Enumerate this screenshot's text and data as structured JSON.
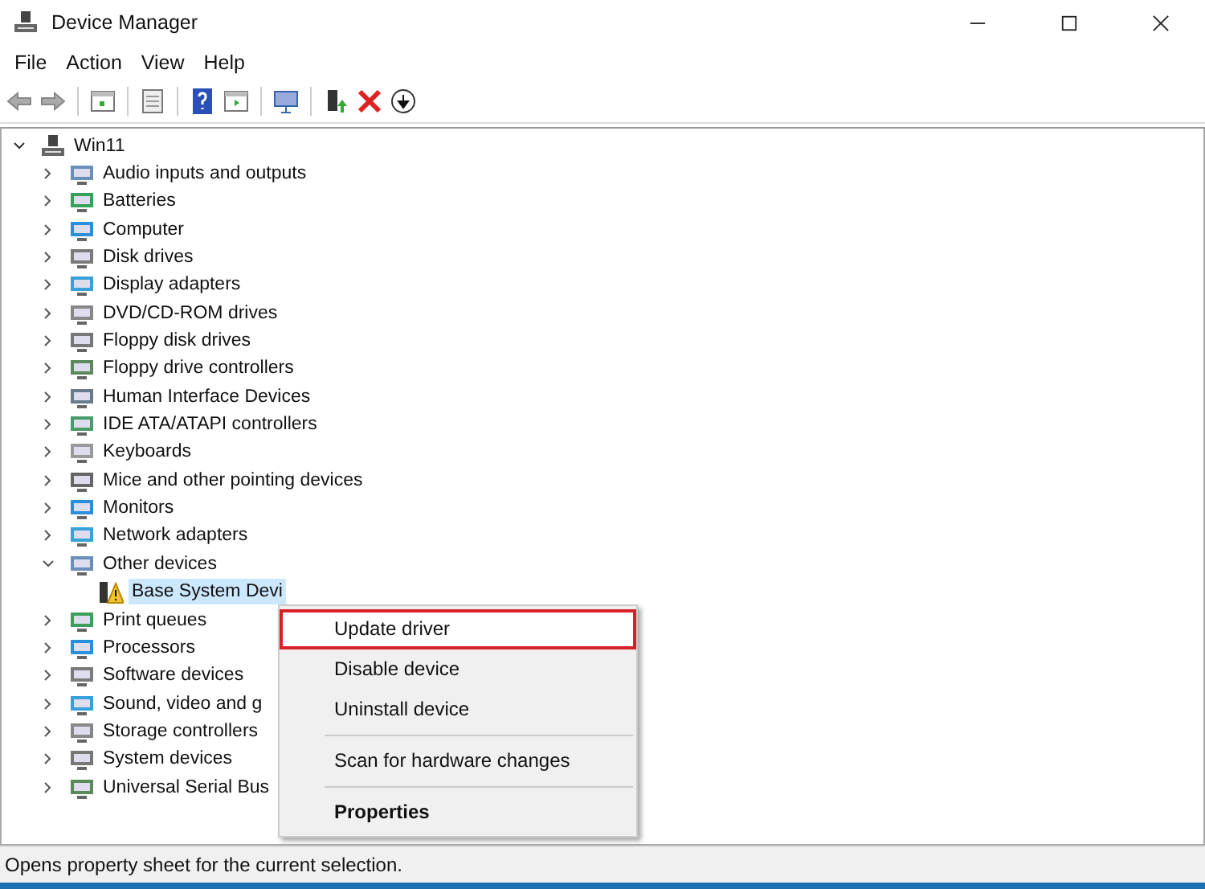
{
  "window": {
    "title": "Device Manager"
  },
  "menu_bar": [
    "File",
    "Action",
    "View",
    "Help"
  ],
  "tree": {
    "label": "Win11",
    "expanded": true,
    "children": [
      {
        "label": "Audio inputs and outputs",
        "expanded": false
      },
      {
        "label": "Batteries",
        "expanded": false
      },
      {
        "label": "Computer",
        "expanded": false
      },
      {
        "label": "Disk drives",
        "expanded": false
      },
      {
        "label": "Display adapters",
        "expanded": false
      },
      {
        "label": "DVD/CD-ROM drives",
        "expanded": false
      },
      {
        "label": "Floppy disk drives",
        "expanded": false
      },
      {
        "label": "Floppy drive controllers",
        "expanded": false
      },
      {
        "label": "Human Interface Devices",
        "expanded": false
      },
      {
        "label": "IDE ATA/ATAPI controllers",
        "expanded": false
      },
      {
        "label": "Keyboards",
        "expanded": false
      },
      {
        "label": "Mice and other pointing devices",
        "expanded": false
      },
      {
        "label": "Monitors",
        "expanded": false
      },
      {
        "label": "Network adapters",
        "expanded": false
      },
      {
        "label": "Other devices",
        "expanded": true,
        "children": [
          {
            "label": "Base System Devi",
            "warning": true,
            "selected": true
          }
        ]
      },
      {
        "label": "Print queues",
        "expanded": false
      },
      {
        "label": "Processors",
        "expanded": false
      },
      {
        "label": "Software devices",
        "expanded": false
      },
      {
        "label": "Sound, video and g",
        "expanded": false
      },
      {
        "label": "Storage controllers",
        "expanded": false
      },
      {
        "label": "System devices",
        "expanded": false
      },
      {
        "label": "Universal Serial Bus",
        "expanded": false
      }
    ]
  },
  "context_menu": [
    {
      "label": "Update driver",
      "highlighted": true,
      "default": false,
      "separator_before": false
    },
    {
      "label": "Disable device",
      "highlighted": false,
      "default": false,
      "separator_before": false
    },
    {
      "label": "Uninstall device",
      "highlighted": false,
      "default": false,
      "separator_before": false
    },
    {
      "label": "Scan for hardware changes",
      "highlighted": false,
      "default": false,
      "separator_before": true
    },
    {
      "label": "Properties",
      "highlighted": false,
      "default": true,
      "separator_before": true
    }
  ],
  "status_bar": "Opens property sheet for the current selection."
}
